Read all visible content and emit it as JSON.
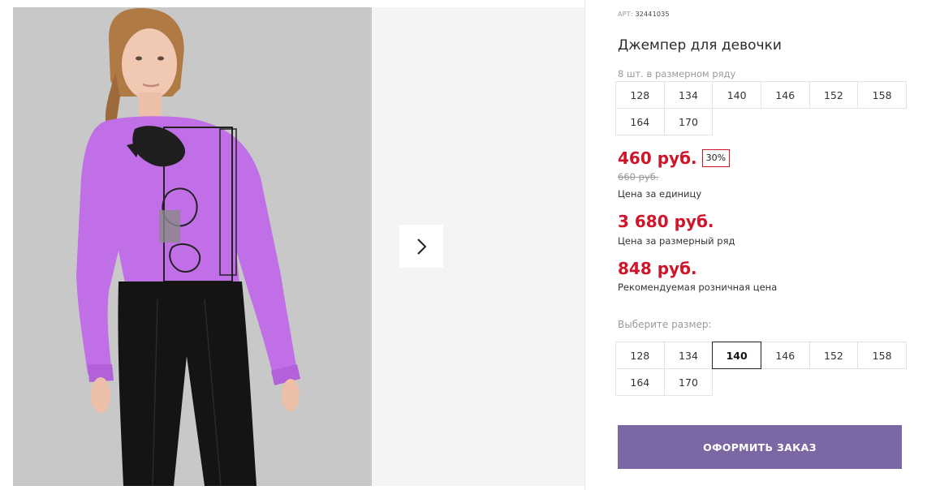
{
  "product": {
    "sku_label": "АРТ:",
    "sku_value": "32441035",
    "title": "Джемпер для девочки",
    "range_count_label": "8 шт. в размерном ряду",
    "range_sizes": [
      "128",
      "134",
      "140",
      "146",
      "152",
      "158",
      "164",
      "170"
    ]
  },
  "pricing": {
    "unit_price": "460 руб.",
    "discount": "30%",
    "old_price": "660 руб.",
    "unit_price_label": "Цена за единицу",
    "range_price": "3 680 руб.",
    "range_price_label": "Цена за размерный ряд",
    "retail_price": "848 руб.",
    "retail_price_label": "Рекомендуемая розничная цена"
  },
  "size_picker": {
    "label": "Выберите размер:",
    "sizes": [
      "128",
      "134",
      "140",
      "146",
      "152",
      "158",
      "164",
      "170"
    ],
    "selected": "140"
  },
  "actions": {
    "order_label": "ОФОРМИТЬ ЗАКАЗ"
  },
  "gallery": {
    "next_icon": "chevron-right-icon"
  },
  "colors": {
    "price_red": "#d0152a",
    "button_purple": "#7a67a4",
    "shirt_lilac": "#c06fe6"
  }
}
